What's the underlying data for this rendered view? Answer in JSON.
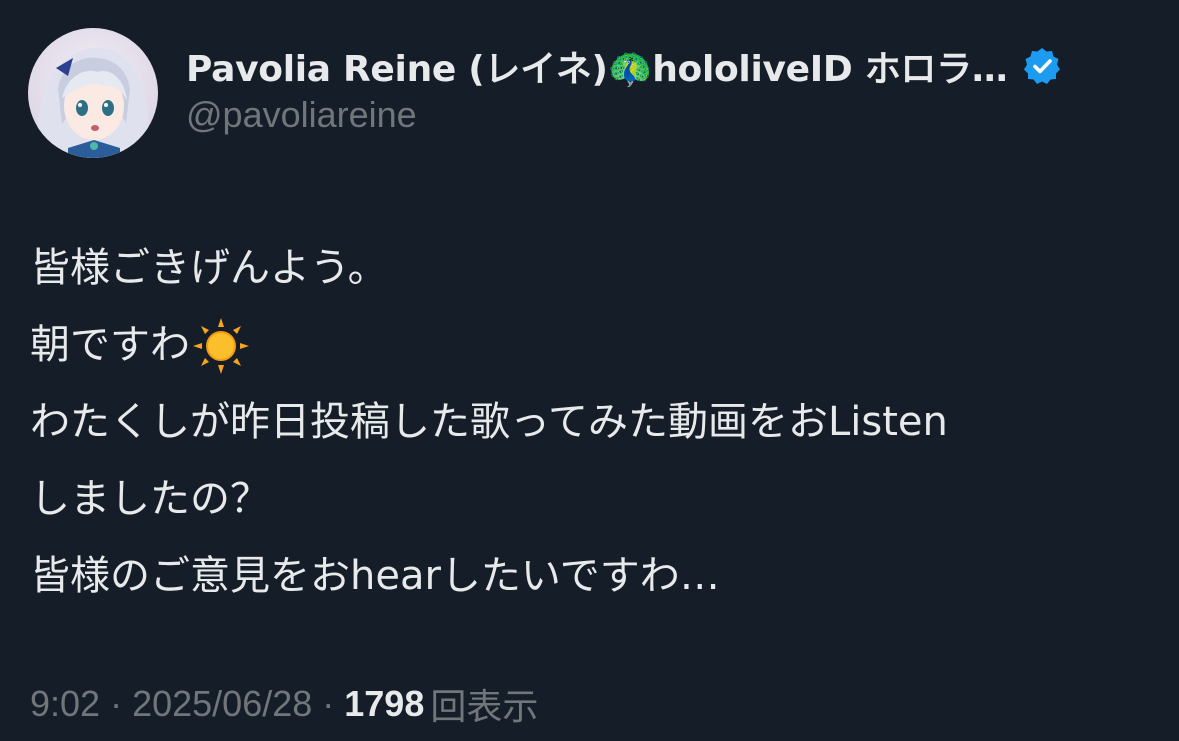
{
  "author": {
    "display_name": "Pavolia Reine (レイネ)🦚hololiveID ホロラ…",
    "handle": "@pavoliareine",
    "verified": true,
    "verified_color": "#1d9bf0"
  },
  "tweet": {
    "lines": [
      "皆様ごきげんよう。",
      "朝ですわ",
      "わたくしが昨日投稿した歌ってみた動画をおListen",
      "しましたの？",
      "皆様のご意見をおhearしたいですわ…"
    ],
    "emoji_after_line_2": "sun-icon"
  },
  "meta": {
    "time": "9:02",
    "separator": "·",
    "date": "2025/06/28",
    "views_count": "1798",
    "views_label": "回表示"
  },
  "colors": {
    "background": "#151d28",
    "primary_text": "#e7e9ea",
    "secondary_text": "#71767b"
  }
}
